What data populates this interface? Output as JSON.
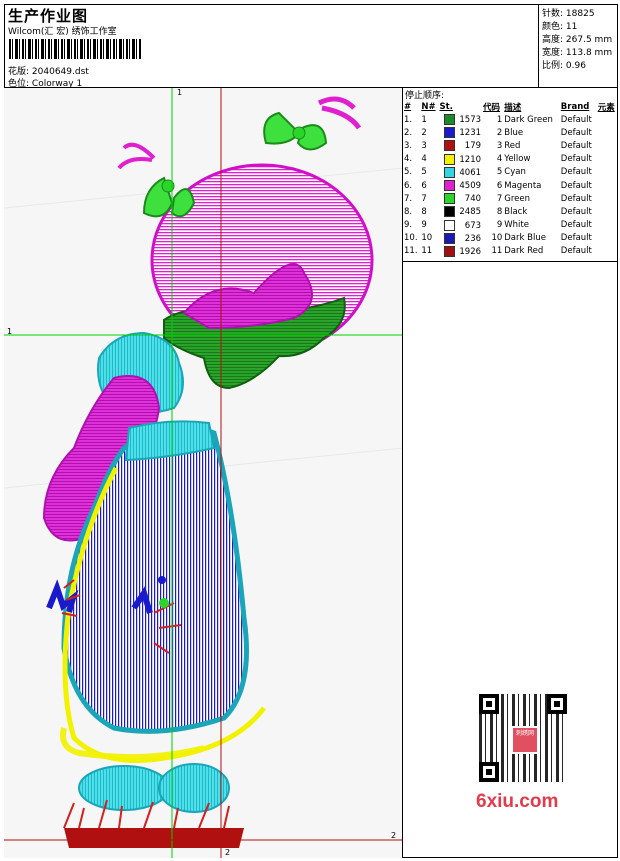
{
  "header": {
    "title": "生产作业图",
    "company": "Wilcom(汇 宏) 绣饰工作室",
    "design_label": "花版:",
    "design_value": "2040649.dst",
    "colorway_label": "色位:",
    "colorway_value": "Colorway 1"
  },
  "stats": {
    "stitches_label": "针数:",
    "stitches_value": "18825",
    "colors_label": "颜色:",
    "colors_value": "11",
    "height_label": "高度:",
    "height_value": "267.5 mm",
    "width_label": "宽度:",
    "width_value": "113.8 mm",
    "scale_label": "比例:",
    "scale_value": "0.96"
  },
  "stop_sequence": {
    "title": "停止顺序:",
    "columns": [
      "#",
      "N#",
      "St.",
      "代码",
      "描述",
      "Brand",
      "元素"
    ],
    "rows": [
      {
        "idx": "1.",
        "n": "1",
        "color": "#1a8a2a",
        "st": "1573",
        "code": "1",
        "desc": "Dark Green",
        "brand": "Default"
      },
      {
        "idx": "2.",
        "n": "2",
        "color": "#1a1acc",
        "st": "1231",
        "code": "2",
        "desc": "Blue",
        "brand": "Default"
      },
      {
        "idx": "3.",
        "n": "3",
        "color": "#b01010",
        "st": "179",
        "code": "3",
        "desc": "Red",
        "brand": "Default"
      },
      {
        "idx": "4.",
        "n": "4",
        "color": "#f2f200",
        "st": "1210",
        "code": "4",
        "desc": "Yellow",
        "brand": "Default"
      },
      {
        "idx": "5.",
        "n": "5",
        "color": "#33d6e0",
        "st": "4061",
        "code": "5",
        "desc": "Cyan",
        "brand": "Default"
      },
      {
        "idx": "6.",
        "n": "6",
        "color": "#e020d0",
        "st": "4509",
        "code": "6",
        "desc": "Magenta",
        "brand": "Default"
      },
      {
        "idx": "7.",
        "n": "7",
        "color": "#2ad62a",
        "st": "740",
        "code": "7",
        "desc": "Green",
        "brand": "Default"
      },
      {
        "idx": "8.",
        "n": "8",
        "color": "#000000",
        "st": "2485",
        "code": "8",
        "desc": "Black",
        "brand": "Default"
      },
      {
        "idx": "9.",
        "n": "9",
        "color": "#ffffff",
        "st": "673",
        "code": "9",
        "desc": "White",
        "brand": "Default"
      },
      {
        "idx": "10.",
        "n": "10",
        "color": "#1a1ab4",
        "st": "236",
        "code": "10",
        "desc": "Dark Blue",
        "brand": "Default"
      },
      {
        "idx": "11.",
        "n": "11",
        "color": "#a01010",
        "st": "1926",
        "code": "11",
        "desc": "Dark Red",
        "brand": "Default"
      }
    ]
  },
  "guides": {
    "v1": "1",
    "h1": "1",
    "v2": "2",
    "h2": "2"
  },
  "watermark": "6xiu.com",
  "qr_label": "刺绣网"
}
